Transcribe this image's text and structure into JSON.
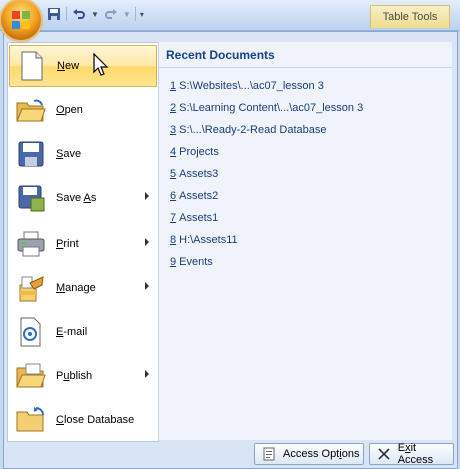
{
  "contextual_tab": "Table Tools",
  "qat": {
    "save": "save-icon",
    "undo": "undo-icon",
    "redo": "redo-icon"
  },
  "commands": [
    {
      "label": "New",
      "mnemonic": "N",
      "rest": "ew",
      "icon": "new-document-icon",
      "submenu": false
    },
    {
      "label": "Open",
      "mnemonic": "O",
      "rest": "pen",
      "icon": "open-folder-icon",
      "submenu": false
    },
    {
      "label": "Save",
      "mnemonic": "S",
      "rest": "ave",
      "icon": "save-icon",
      "submenu": false
    },
    {
      "label": "Save As",
      "pre": "Save ",
      "mnemonic": "A",
      "rest": "s",
      "icon": "save-as-icon",
      "submenu": true
    },
    {
      "label": "Print",
      "mnemonic": "P",
      "rest": "rint",
      "icon": "printer-icon",
      "submenu": true
    },
    {
      "label": "Manage",
      "mnemonic": "M",
      "rest": "anage",
      "icon": "manage-icon",
      "submenu": true
    },
    {
      "label": "E-mail",
      "mnemonic": "E",
      "rest": "-mail",
      "icon": "email-icon",
      "submenu": false
    },
    {
      "label": "Publish",
      "mnemonic": "u",
      "pre": "P",
      "rest": "blish",
      "icon": "publish-icon",
      "submenu": true
    },
    {
      "label": "Close Database",
      "mnemonic": "C",
      "rest": "lose Database",
      "icon": "close-database-icon",
      "submenu": false
    }
  ],
  "recent": {
    "title": "Recent Documents",
    "items": [
      {
        "num": "1",
        "text": "S:\\Websites\\...\\ac07_lesson 3"
      },
      {
        "num": "2",
        "text": "S:\\Learning Content\\...\\ac07_lesson 3"
      },
      {
        "num": "3",
        "text": "S:\\...\\Ready-2-Read Database"
      },
      {
        "num": "4",
        "text": "Projects"
      },
      {
        "num": "5",
        "text": "Assets3"
      },
      {
        "num": "6",
        "text": "Assets2"
      },
      {
        "num": "7",
        "text": "Assets1"
      },
      {
        "num": "8",
        "text": "H:\\Assets11"
      },
      {
        "num": "9",
        "text": "Events"
      }
    ]
  },
  "footer": {
    "options_pre": "Access Opt",
    "options_mn": "i",
    "options_post": "ons",
    "exit_pre": "",
    "exit_mn": "x",
    "exit_first": "E",
    "exit_post": "it Access"
  }
}
